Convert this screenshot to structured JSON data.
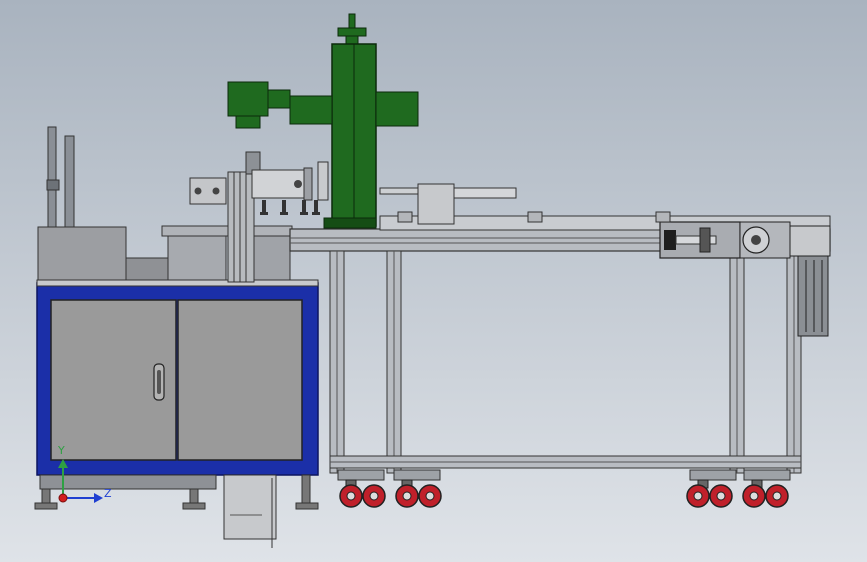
{
  "viewport": {
    "background_top": "#a9b3bf",
    "background_bottom": "#dfe3e8"
  },
  "triad": {
    "y_label": "Y",
    "z_label": "Z",
    "y_color": "#2ea043",
    "z_color": "#1f3fd1",
    "x_color": "#d21f1f"
  },
  "colors": {
    "frame_blue": "#1b2fa8",
    "cabinet_gray": "#9a9a9a",
    "spindle_green": "#1f6a1f",
    "aluminum": "#b8bcc2",
    "wheel_red": "#c0202a"
  }
}
